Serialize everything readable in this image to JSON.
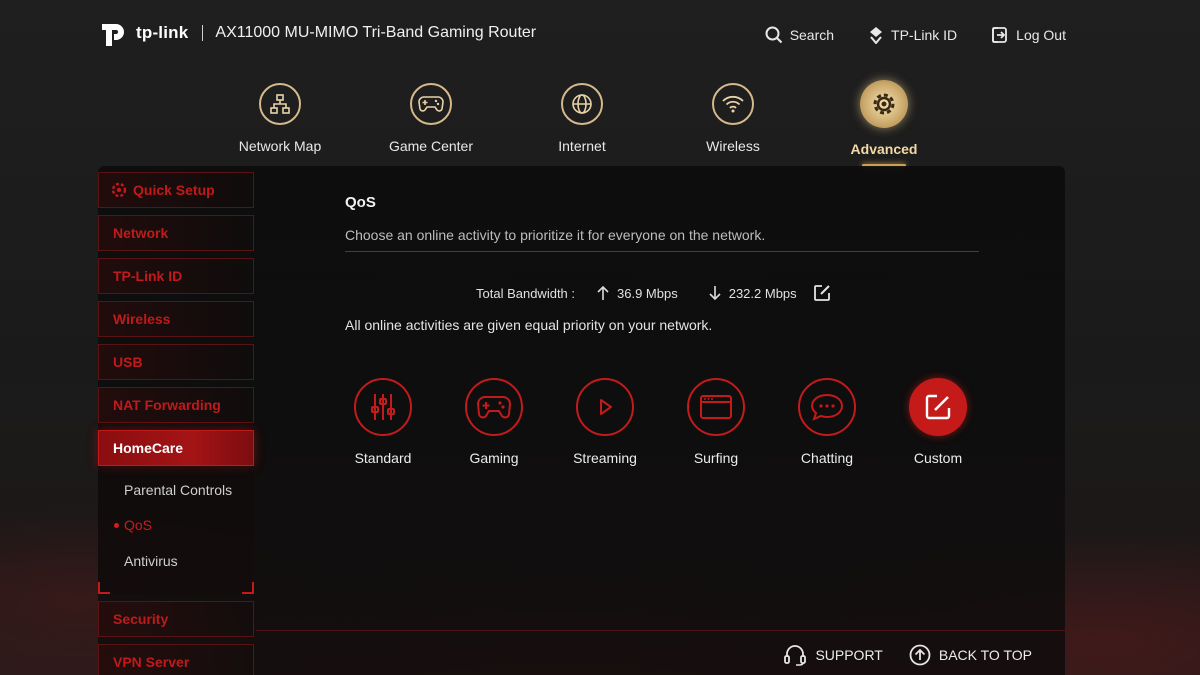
{
  "header": {
    "brand": "tp-link",
    "product": "AX11000 MU-MIMO Tri-Band Gaming Router",
    "actions": [
      {
        "label": "Search",
        "icon": "search-icon"
      },
      {
        "label": "TP-Link ID",
        "icon": "tplink-id-icon"
      },
      {
        "label": "Log Out",
        "icon": "logout-icon"
      }
    ]
  },
  "main_nav": [
    {
      "label": "Network Map",
      "icon": "network-map-icon"
    },
    {
      "label": "Game Center",
      "icon": "gamepad-icon"
    },
    {
      "label": "Internet",
      "icon": "globe-icon"
    },
    {
      "label": "Wireless",
      "icon": "wifi-icon"
    },
    {
      "label": "Advanced",
      "icon": "gear-icon",
      "active": true
    }
  ],
  "sidebar": {
    "items": [
      {
        "label": "Quick Setup"
      },
      {
        "label": "Network"
      },
      {
        "label": "TP-Link ID"
      },
      {
        "label": "Wireless"
      },
      {
        "label": "USB"
      },
      {
        "label": "NAT Forwarding"
      },
      {
        "label": "HomeCare",
        "open": true
      },
      {
        "label": "Security"
      },
      {
        "label": "VPN Server"
      }
    ],
    "homecare_sub": [
      {
        "label": "Parental Controls"
      },
      {
        "label": "QoS",
        "active": true
      },
      {
        "label": "Antivirus"
      }
    ]
  },
  "qos": {
    "title": "QoS",
    "description": "Choose an online activity to prioritize it for everyone on the network.",
    "bandwidth_label": "Total Bandwidth :",
    "upload": "36.9 Mbps",
    "download": "232.2 Mbps",
    "priority_note": "All online activities are given equal priority on your network.",
    "modes": [
      {
        "label": "Standard",
        "icon": "sliders-icon"
      },
      {
        "label": "Gaming",
        "icon": "gamepad-icon"
      },
      {
        "label": "Streaming",
        "icon": "play-icon"
      },
      {
        "label": "Surfing",
        "icon": "browser-icon"
      },
      {
        "label": "Chatting",
        "icon": "chat-icon"
      },
      {
        "label": "Custom",
        "icon": "edit-icon",
        "active": true
      }
    ]
  },
  "footer": {
    "support": "SUPPORT",
    "back_to_top": "BACK TO TOP"
  },
  "colors": {
    "accent_red": "#c41a1a",
    "gold": "#caa157",
    "background": "#1c1c1c"
  }
}
